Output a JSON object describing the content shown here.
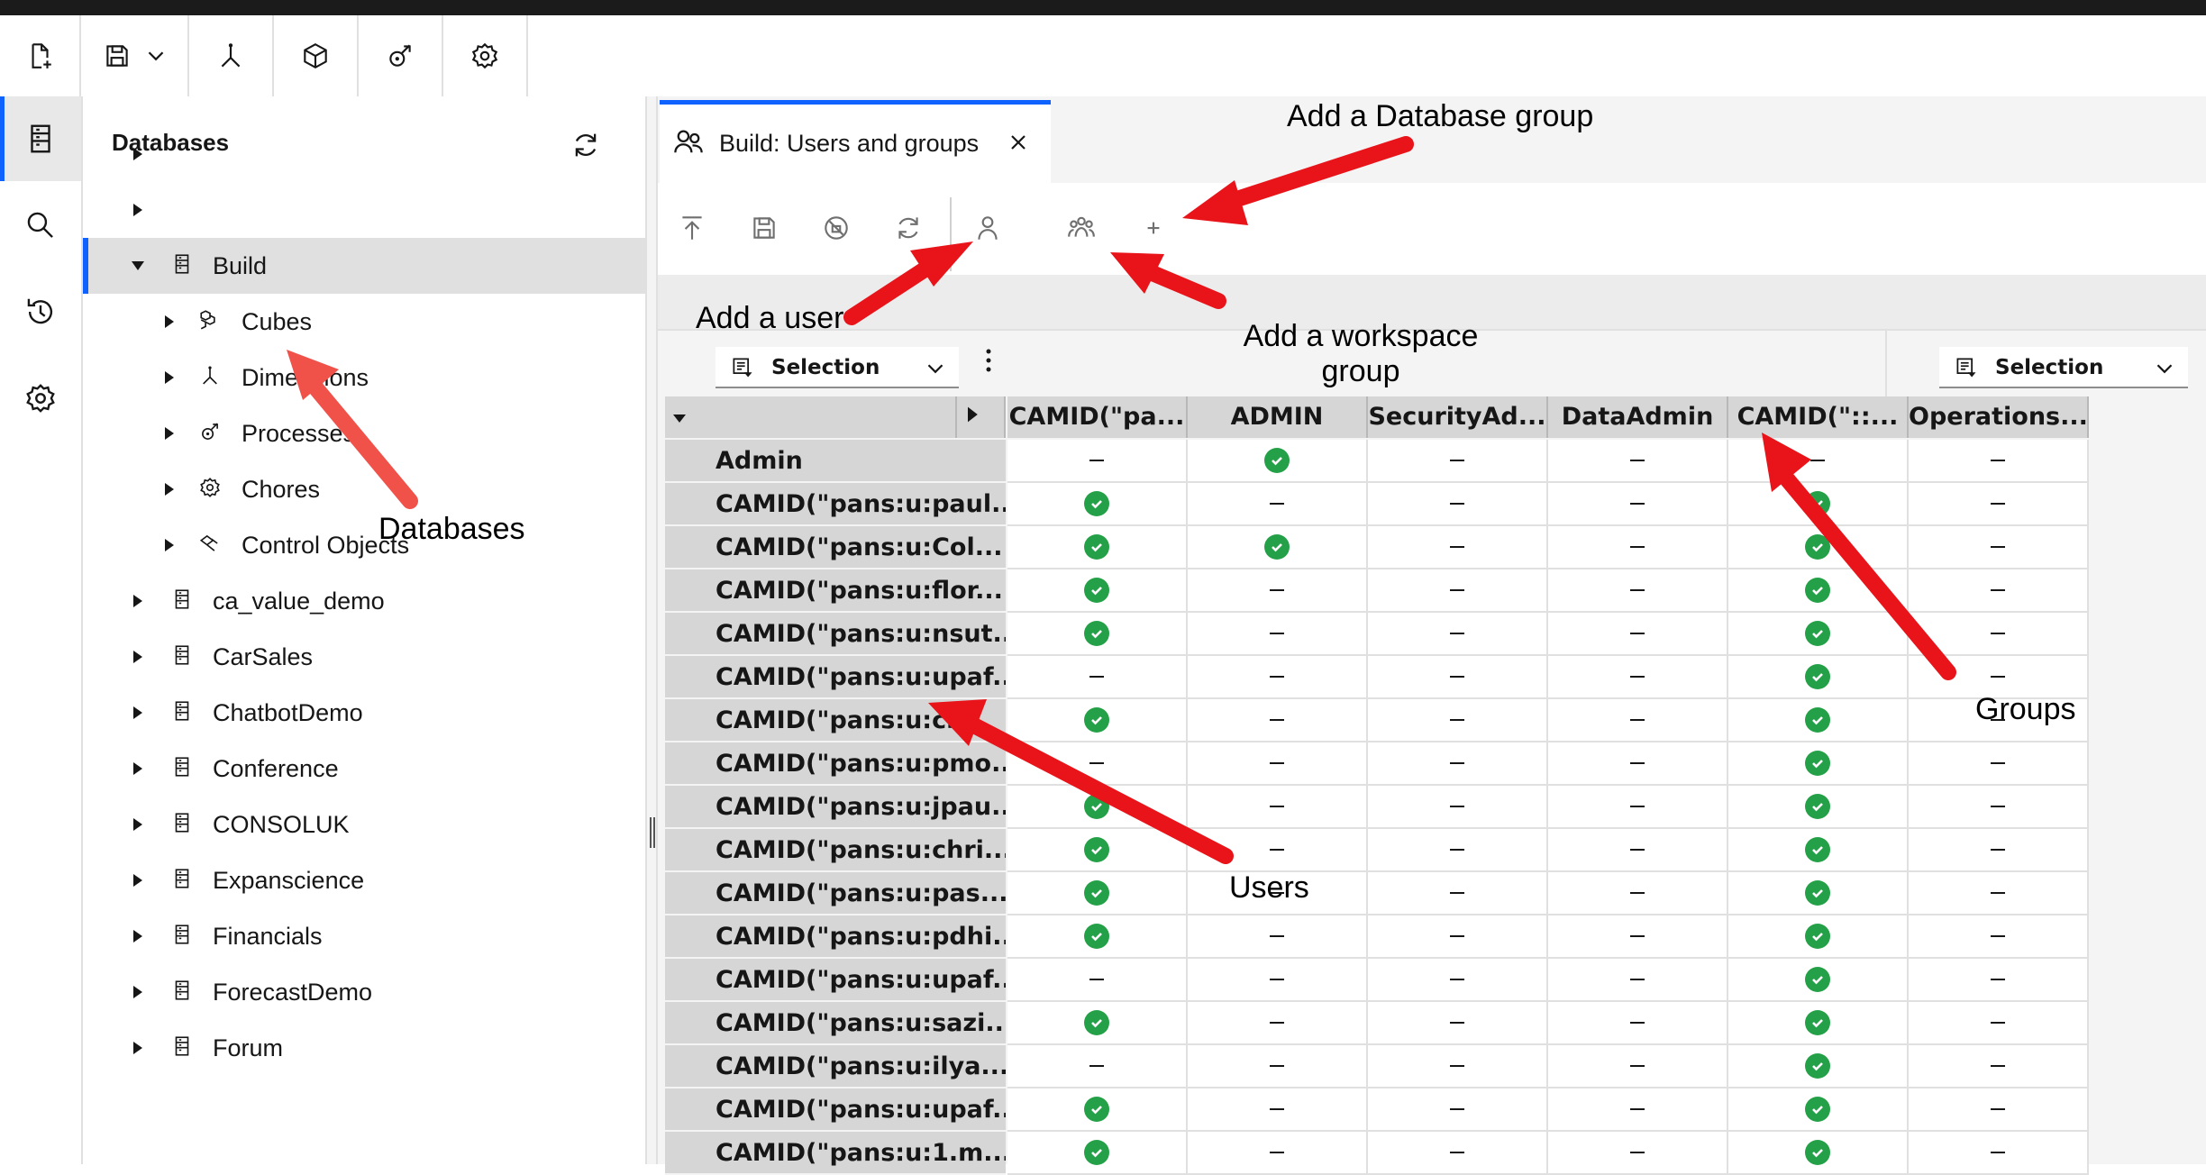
{
  "toolbar": {
    "buttons": [
      {
        "icon": "new-file-icon"
      },
      {
        "icon": "save-icon",
        "dropdown": true
      },
      {
        "icon": "dimension-icon"
      },
      {
        "icon": "cube-icon"
      },
      {
        "icon": "process-icon"
      },
      {
        "icon": "chore-icon"
      }
    ]
  },
  "leftnav": {
    "items": [
      {
        "icon": "database-icon",
        "active": true
      },
      {
        "icon": "search-icon"
      },
      {
        "icon": "history-icon"
      },
      {
        "icon": "settings-icon"
      }
    ]
  },
  "databases_panel": {
    "title": "Databases",
    "items": [
      {
        "label": "",
        "level": 0,
        "expanded": false
      },
      {
        "label": "",
        "level": 0,
        "expanded": false
      },
      {
        "label": "Build",
        "level": 0,
        "expanded": true,
        "selected": true
      },
      {
        "label": "Cubes",
        "level": 1,
        "icon": "cubes-icon"
      },
      {
        "label": "Dimensions",
        "level": 1,
        "icon": "dimension-icon"
      },
      {
        "label": "Processes",
        "level": 1,
        "icon": "process-icon"
      },
      {
        "label": "Chores",
        "level": 1,
        "icon": "chore-icon"
      },
      {
        "label": "Control Objects",
        "level": 1,
        "icon": "control-objects-icon"
      },
      {
        "label": "ca_value_demo",
        "level": 0
      },
      {
        "label": "CarSales",
        "level": 0
      },
      {
        "label": "ChatbotDemo",
        "level": 0
      },
      {
        "label": "Conference",
        "level": 0
      },
      {
        "label": "CONSOLUK",
        "level": 0
      },
      {
        "label": "Expanscience",
        "level": 0
      },
      {
        "label": "Financials",
        "level": 0
      },
      {
        "label": "ForecastDemo",
        "level": 0
      },
      {
        "label": "Forum",
        "level": 0
      }
    ]
  },
  "tab": {
    "label": "Build: Users and groups"
  },
  "view_toolbar": {
    "buttons": [
      "publish-icon",
      "save-icon",
      "discard-icon",
      "refresh-icon",
      "add-user-icon",
      "add-workspace-group-icon",
      "add-database-group-icon"
    ]
  },
  "selectors": {
    "left": "Selection",
    "right": "Selection"
  },
  "grid": {
    "columns": [
      "CAMID(\"pa...",
      "ADMIN",
      "SecurityAd...",
      "DataAdmin",
      "CAMID(\"::...",
      "Operations..."
    ],
    "rows": [
      {
        "name": "Admin",
        "values": [
          0,
          1,
          0,
          0,
          0,
          0
        ]
      },
      {
        "name": "CAMID(\"pans:u:paul...",
        "values": [
          1,
          0,
          0,
          0,
          1,
          0
        ]
      },
      {
        "name": "CAMID(\"pans:u:Col...",
        "values": [
          1,
          1,
          0,
          0,
          1,
          0
        ]
      },
      {
        "name": "CAMID(\"pans:u:flor...",
        "values": [
          1,
          0,
          0,
          0,
          1,
          0
        ]
      },
      {
        "name": "CAMID(\"pans:u:nsut...",
        "values": [
          1,
          0,
          0,
          0,
          1,
          0
        ]
      },
      {
        "name": "CAMID(\"pans:u:upaf...",
        "values": [
          0,
          0,
          0,
          0,
          1,
          0
        ]
      },
      {
        "name": "CAMID(\"pans:u:cl...",
        "values": [
          1,
          0,
          0,
          0,
          1,
          0
        ]
      },
      {
        "name": "CAMID(\"pans:u:pmo...",
        "values": [
          0,
          0,
          0,
          0,
          1,
          0
        ]
      },
      {
        "name": "CAMID(\"pans:u:jpau...",
        "values": [
          1,
          0,
          0,
          0,
          1,
          0
        ]
      },
      {
        "name": "CAMID(\"pans:u:chri...",
        "values": [
          1,
          0,
          0,
          0,
          1,
          0
        ]
      },
      {
        "name": "CAMID(\"pans:u:pas...",
        "values": [
          1,
          0,
          0,
          0,
          1,
          0
        ]
      },
      {
        "name": "CAMID(\"pans:u:pdhi...",
        "values": [
          1,
          0,
          0,
          0,
          1,
          0
        ]
      },
      {
        "name": "CAMID(\"pans:u:upaf...",
        "values": [
          0,
          0,
          0,
          0,
          1,
          0
        ]
      },
      {
        "name": "CAMID(\"pans:u:sazi...",
        "values": [
          1,
          0,
          0,
          0,
          1,
          0
        ]
      },
      {
        "name": "CAMID(\"pans:u:ilya....",
        "values": [
          0,
          0,
          0,
          0,
          1,
          0
        ]
      },
      {
        "name": "CAMID(\"pans:u:upaf...",
        "values": [
          1,
          0,
          0,
          0,
          1,
          0
        ]
      },
      {
        "name": "CAMID(\"pans:u:1.m...",
        "values": [
          1,
          0,
          0,
          0,
          1,
          0
        ]
      }
    ]
  },
  "annotations": {
    "add_database_group": "Add a Database group",
    "add_user": "Add a user",
    "add_workspace_group_line1": "Add a workspace",
    "add_workspace_group_line2": "group",
    "databases": "Databases",
    "groups": "Groups",
    "users": "Users"
  },
  "colors": {
    "accent": "#0f62fe",
    "check": "#24a148",
    "arrow": "#e8141a",
    "arrow_highlight": "#f0524a"
  }
}
